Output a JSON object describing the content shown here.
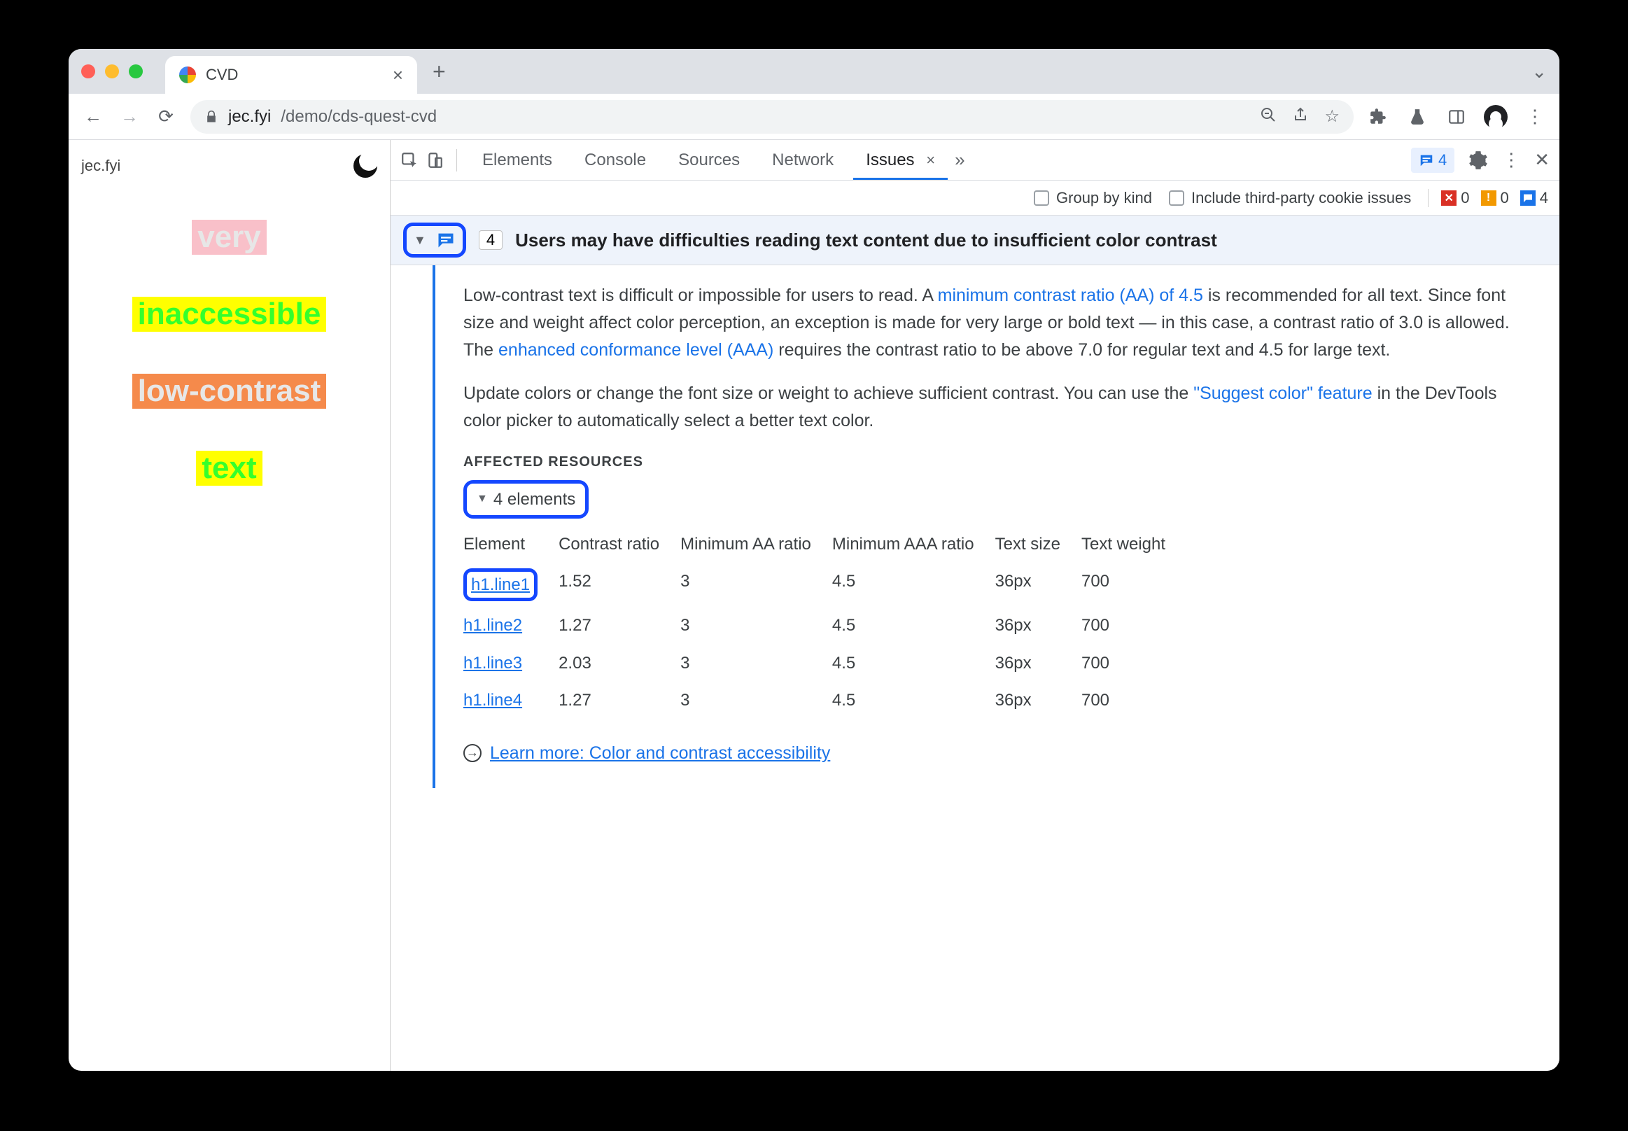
{
  "tab": {
    "title": "CVD"
  },
  "url": {
    "host": "jec.fyi",
    "path": "/demo/cds-quest-cvd"
  },
  "page": {
    "brand": "jec.fyi",
    "samples": [
      "very",
      "inaccessible",
      "low-contrast",
      "text"
    ]
  },
  "devtools": {
    "tabs": [
      "Elements",
      "Console",
      "Sources",
      "Network"
    ],
    "active_tab": "Issues",
    "chip_count": "4",
    "subbar": {
      "group_label": "Group by kind",
      "thirdparty_label": "Include third-party cookie issues",
      "red": "0",
      "orange": "0",
      "blue": "4"
    }
  },
  "issue": {
    "count_badge": "4",
    "title": "Users may have difficulties reading text content due to insufficient color contrast",
    "p1_a": "Low-contrast text is difficult or impossible for users to read. A ",
    "link1": "minimum contrast ratio (AA) of 4.5",
    "p1_b": " is recommended for all text. Since font size and weight affect color perception, an exception is made for very large or bold text — in this case, a contrast ratio of 3.0 is allowed. The ",
    "link2": "enhanced conformance level (AAA)",
    "p1_c": " requires the contrast ratio to be above 7.0 for regular text and 4.5 for large text.",
    "p2_a": "Update colors or change the font size or weight to achieve sufficient contrast. You can use the ",
    "link3": "\"Suggest color\" feature",
    "p2_b": " in the DevTools color picker to automatically select a better text color.",
    "affected_heading": "AFFECTED RESOURCES",
    "elements_summary": "4 elements",
    "table_headers": [
      "Element",
      "Contrast ratio",
      "Minimum AA ratio",
      "Minimum AAA ratio",
      "Text size",
      "Text weight"
    ],
    "rows": [
      {
        "el": "h1.line1",
        "cr": "1.52",
        "aa": "3",
        "aaa": "4.5",
        "size": "36px",
        "weight": "700"
      },
      {
        "el": "h1.line2",
        "cr": "1.27",
        "aa": "3",
        "aaa": "4.5",
        "size": "36px",
        "weight": "700"
      },
      {
        "el": "h1.line3",
        "cr": "2.03",
        "aa": "3",
        "aaa": "4.5",
        "size": "36px",
        "weight": "700"
      },
      {
        "el": "h1.line4",
        "cr": "1.27",
        "aa": "3",
        "aaa": "4.5",
        "size": "36px",
        "weight": "700"
      }
    ],
    "learn_more": "Learn more: Color and contrast accessibility"
  }
}
